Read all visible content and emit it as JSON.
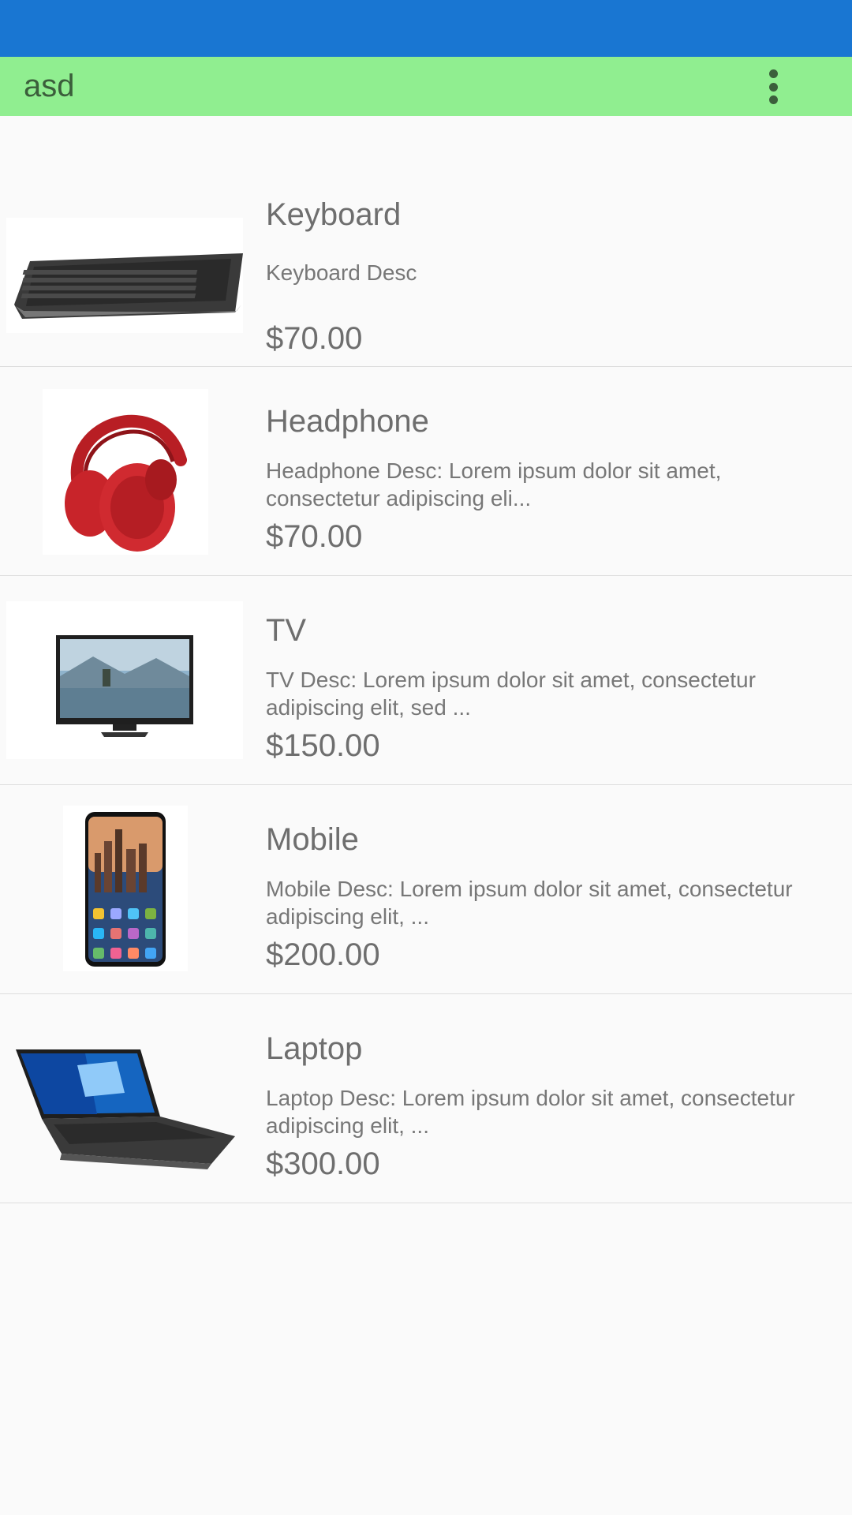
{
  "toolbar": {
    "title": "asd",
    "menu_icon": "more-vert-icon"
  },
  "colors": {
    "status_bar": "#1976D2",
    "toolbar": "#90EE90"
  },
  "products": [
    {
      "name": "Keyboard",
      "desc": "Keyboard Desc",
      "price": "$70.00",
      "image": "keyboard-image"
    },
    {
      "name": "Headphone",
      "desc": "Headphone Desc: Lorem ipsum dolor sit amet, consectetur adipiscing eli...",
      "price": "$70.00",
      "image": "headphone-image"
    },
    {
      "name": "TV",
      "desc": "TV Desc: Lorem ipsum dolor sit amet, consectetur adipiscing elit, sed ...",
      "price": "$150.00",
      "image": "tv-image"
    },
    {
      "name": "Mobile",
      "desc": "Mobile Desc: Lorem ipsum dolor sit amet, consectetur adipiscing elit, ...",
      "price": "$200.00",
      "image": "mobile-image"
    },
    {
      "name": "Laptop",
      "desc": "Laptop Desc: Lorem ipsum dolor sit amet, consectetur adipiscing elit, ...",
      "price": "$300.00",
      "image": "laptop-image"
    }
  ]
}
